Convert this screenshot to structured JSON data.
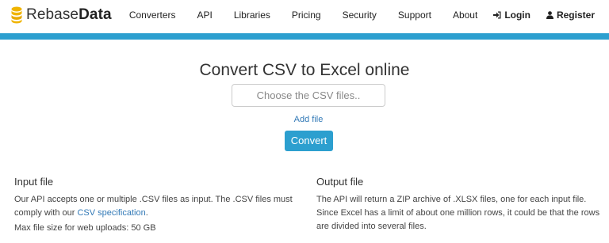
{
  "brand": {
    "name_light": "Rebase",
    "name_bold": "Data",
    "color": "#2c9fcf",
    "icon": "database-icon"
  },
  "nav": {
    "items": [
      "Converters",
      "API",
      "Libraries",
      "Pricing",
      "Security",
      "Support",
      "About"
    ],
    "login": {
      "label": "Login",
      "icon": "sign-in-icon"
    },
    "register": {
      "label": "Register",
      "icon": "user-icon"
    }
  },
  "main": {
    "title": "Convert CSV to Excel online",
    "file_input_placeholder": "Choose the CSV files..",
    "add_file_label": "Add file",
    "convert_label": "Convert"
  },
  "input_section": {
    "heading": "Input file",
    "text_before_link": "Our API accepts one or multiple .CSV files as input. The .CSV files must comply with our ",
    "link_text": "CSV specification",
    "text_after_link": ".",
    "max_size": "Max file size for web uploads: 50 GB"
  },
  "output_section": {
    "heading": "Output file",
    "text": "The API will return a ZIP archive of .XLSX files, one for each input file. Since Excel has a limit of about one million rows, it could be that the rows are divided into several files."
  }
}
